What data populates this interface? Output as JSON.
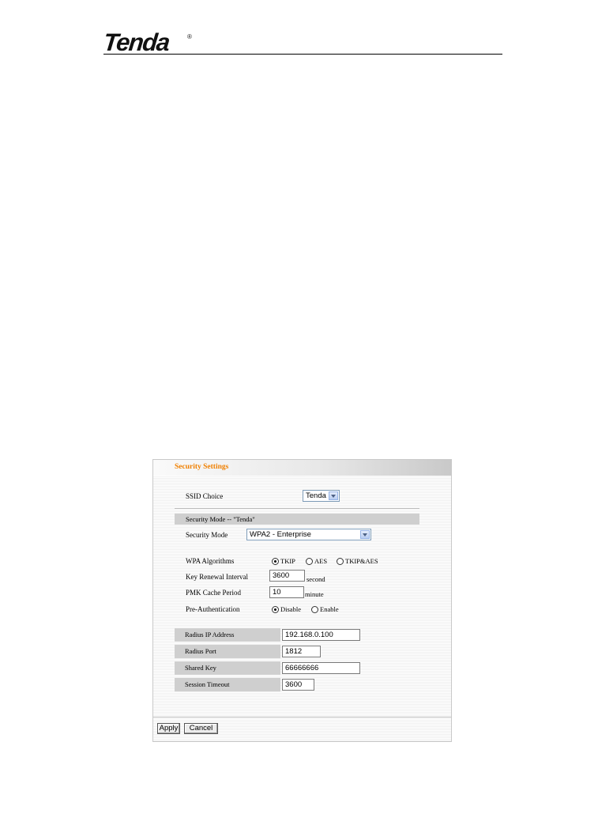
{
  "header": {
    "logo_text": "Tenda",
    "logo_mark": "®"
  },
  "panel": {
    "title": "Security Settings",
    "ssid_choice": {
      "label": "SSID Choice",
      "value": "Tenda"
    },
    "section_title": "Security Mode -- \"Tenda\"",
    "security_mode": {
      "label": "Security Mode",
      "value": "WPA2 - Enterprise"
    },
    "wpa_algorithms": {
      "label": "WPA Algorithms",
      "options": [
        "TKIP",
        "AES",
        "TKIP&AES"
      ],
      "selected": "TKIP"
    },
    "key_renewal": {
      "label": "Key Renewal Interval",
      "value": "3600",
      "unit": "second"
    },
    "pmk_cache": {
      "label": "PMK Cache Period",
      "value": "10",
      "unit": "minute"
    },
    "pre_auth": {
      "label": "Pre-Authentication",
      "options": [
        "Disable",
        "Enable"
      ],
      "selected": "Disable"
    },
    "radius_ip": {
      "label": "Radius IP Address",
      "value": "192.168.0.100"
    },
    "radius_port": {
      "label": "Radius Port",
      "value": "1812"
    },
    "shared_key": {
      "label": "Shared Key",
      "value": "66666666"
    },
    "session_timeout": {
      "label": "Session Timeout",
      "value": "3600"
    },
    "buttons": {
      "apply": "Apply",
      "cancel": "Cancel"
    }
  },
  "colors": {
    "title_orange": "#f08000",
    "grey_bar": "#cfcfcf",
    "select_border": "#7f9db9"
  }
}
